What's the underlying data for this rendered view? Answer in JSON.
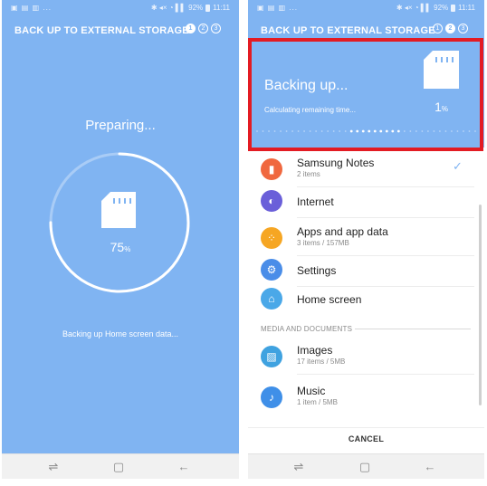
{
  "status_bar": {
    "left_icons": "▣ ▤ ▥ ...",
    "right_icons": "✱ ◂× ◔ ▌▌",
    "battery": "92%",
    "time": "11:11"
  },
  "header": {
    "title": "BACK UP TO EXTERNAL STORAGE",
    "steps": [
      "1",
      "2",
      "3"
    ]
  },
  "left_screen": {
    "status_text": "Preparing...",
    "progress_value": "75",
    "progress_unit": "%",
    "progress_fraction": 0.75,
    "detail_text": "Backing up Home screen data..."
  },
  "right_screen": {
    "status_text": "Backing up...",
    "detail_text": "Calculating remaining time...",
    "progress_value": "1",
    "progress_unit": "%",
    "items": [
      {
        "title": "Samsung Notes",
        "subtitle": "2 items",
        "icon": "notes-icon",
        "color": "#f0683f",
        "glyph": "▮",
        "checked": true
      },
      {
        "title": "Internet",
        "subtitle": "",
        "icon": "internet-icon",
        "color": "#6a5fd9",
        "glyph": "◐",
        "checked": false
      },
      {
        "title": "Apps and app data",
        "subtitle": "3 items / 157MB",
        "icon": "apps-icon",
        "color": "#f6a623",
        "glyph": "⁘",
        "checked": false
      },
      {
        "title": "Settings",
        "subtitle": "",
        "icon": "settings-icon",
        "color": "#4a8de8",
        "glyph": "⚙",
        "checked": false
      },
      {
        "title": "Home screen",
        "subtitle": "",
        "icon": "home-screen-icon",
        "color": "#4aa8e8",
        "glyph": "⌂",
        "checked": false
      }
    ],
    "section_header": "MEDIA AND DOCUMENTS",
    "media_items": [
      {
        "title": "Images",
        "subtitle": "17 items / 5MB",
        "icon": "images-icon",
        "color": "#3fa2e0",
        "glyph": "▨"
      },
      {
        "title": "Music",
        "subtitle": "1 item / 5MB",
        "icon": "music-icon",
        "color": "#3f8fe8",
        "glyph": "♪"
      }
    ],
    "cancel_label": "CANCEL"
  },
  "navbar": {
    "recent_glyph": "⇌",
    "home_glyph": "▢",
    "back_glyph": "←"
  },
  "colors": {
    "accent": "#80b4f2",
    "highlight": "#e31b23"
  }
}
